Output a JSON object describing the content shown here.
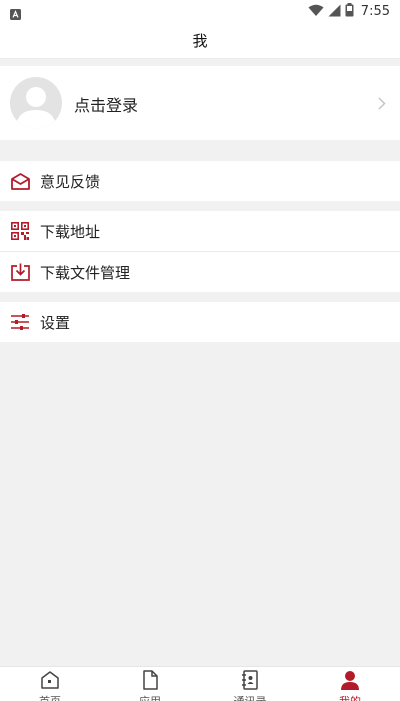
{
  "status_bar": {
    "time": "7:55"
  },
  "header": {
    "title": "我"
  },
  "profile": {
    "login_label": "点击登录"
  },
  "menu": {
    "feedback": "意见反馈",
    "download_address": "下载地址",
    "download_manager": "下载文件管理",
    "settings": "设置"
  },
  "tabs": [
    {
      "label": "首页",
      "icon": "home-icon"
    },
    {
      "label": "应用",
      "icon": "document-icon"
    },
    {
      "label": "通讯录",
      "icon": "contacts-icon"
    },
    {
      "label": "我的",
      "icon": "user-icon",
      "active": true
    }
  ],
  "colors": {
    "accent": "#b31b2a",
    "background": "#f1f1f1"
  }
}
